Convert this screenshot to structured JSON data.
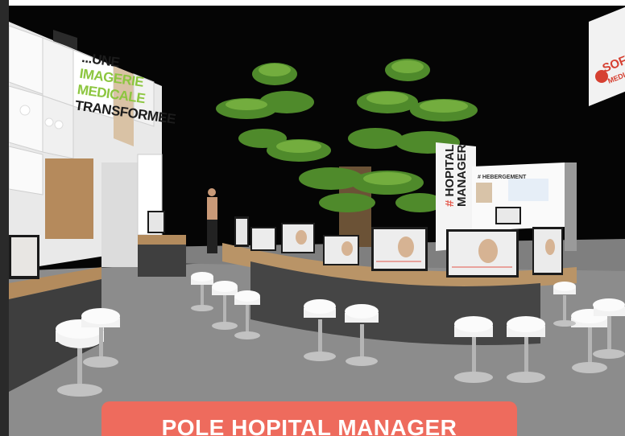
{
  "image": {
    "description_free": true,
    "colors": {
      "banner": "#ee6b5d",
      "accent_red": "#e4574a",
      "accent_green": "#8cc63f",
      "background": "#050505"
    }
  },
  "left_wall": {
    "headline_lines": [
      "...UNE",
      "IMAGERIE",
      "MEDICALE",
      "TRANSFORMEE"
    ]
  },
  "tower": {
    "hash": "#",
    "label_line1": "HOPITAL",
    "label_line2": "MANAGER"
  },
  "back_panel": {
    "label": "# HEBERGEMENT"
  },
  "corner_sign": {
    "brand": "SOFTW",
    "sub": "MEDI"
  },
  "banner": {
    "text": "POLE HOPITAL MANAGER"
  }
}
